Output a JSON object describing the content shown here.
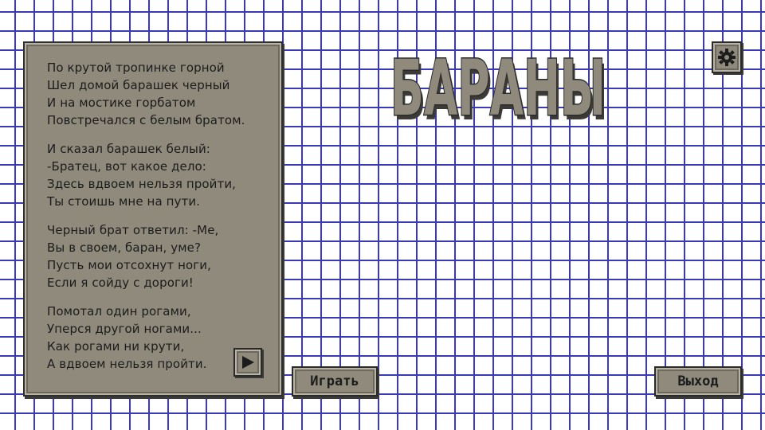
{
  "title": "БАРАНЫ",
  "poem": {
    "stanzas": [
      [
        "По крутой тропинке горной",
        "Шел домой барашек черный",
        "И на мостике горбатом",
        "Повстречался с белым братом."
      ],
      [
        "И сказал барашек белый:",
        "-Братец, вот какое дело:",
        "Здесь вдвоем нельзя пройти,",
        "Ты стоишь мне на пути."
      ],
      [
        "Черный брат ответил: -Ме,",
        "Вы в своем, баран, уме?",
        "Пусть мои отсохнут ноги,",
        "Если я сойду с дороги!"
      ],
      [
        "Помотал один рогами,",
        "Уперся другой ногами...",
        "Как рогами ни крути,",
        "А вдвоем нельзя пройти."
      ]
    ]
  },
  "buttons": {
    "play": "Играть",
    "exit": "Выход",
    "next_icon": "play-triangle-icon",
    "settings_icon": "gear-icon"
  },
  "colors": {
    "grid": "#3a3ab8",
    "panel": "#8f8a7b",
    "border": "#2a2a2a",
    "logo_face": "#8f8a7b",
    "logo_shadow": "#3c3a36"
  }
}
